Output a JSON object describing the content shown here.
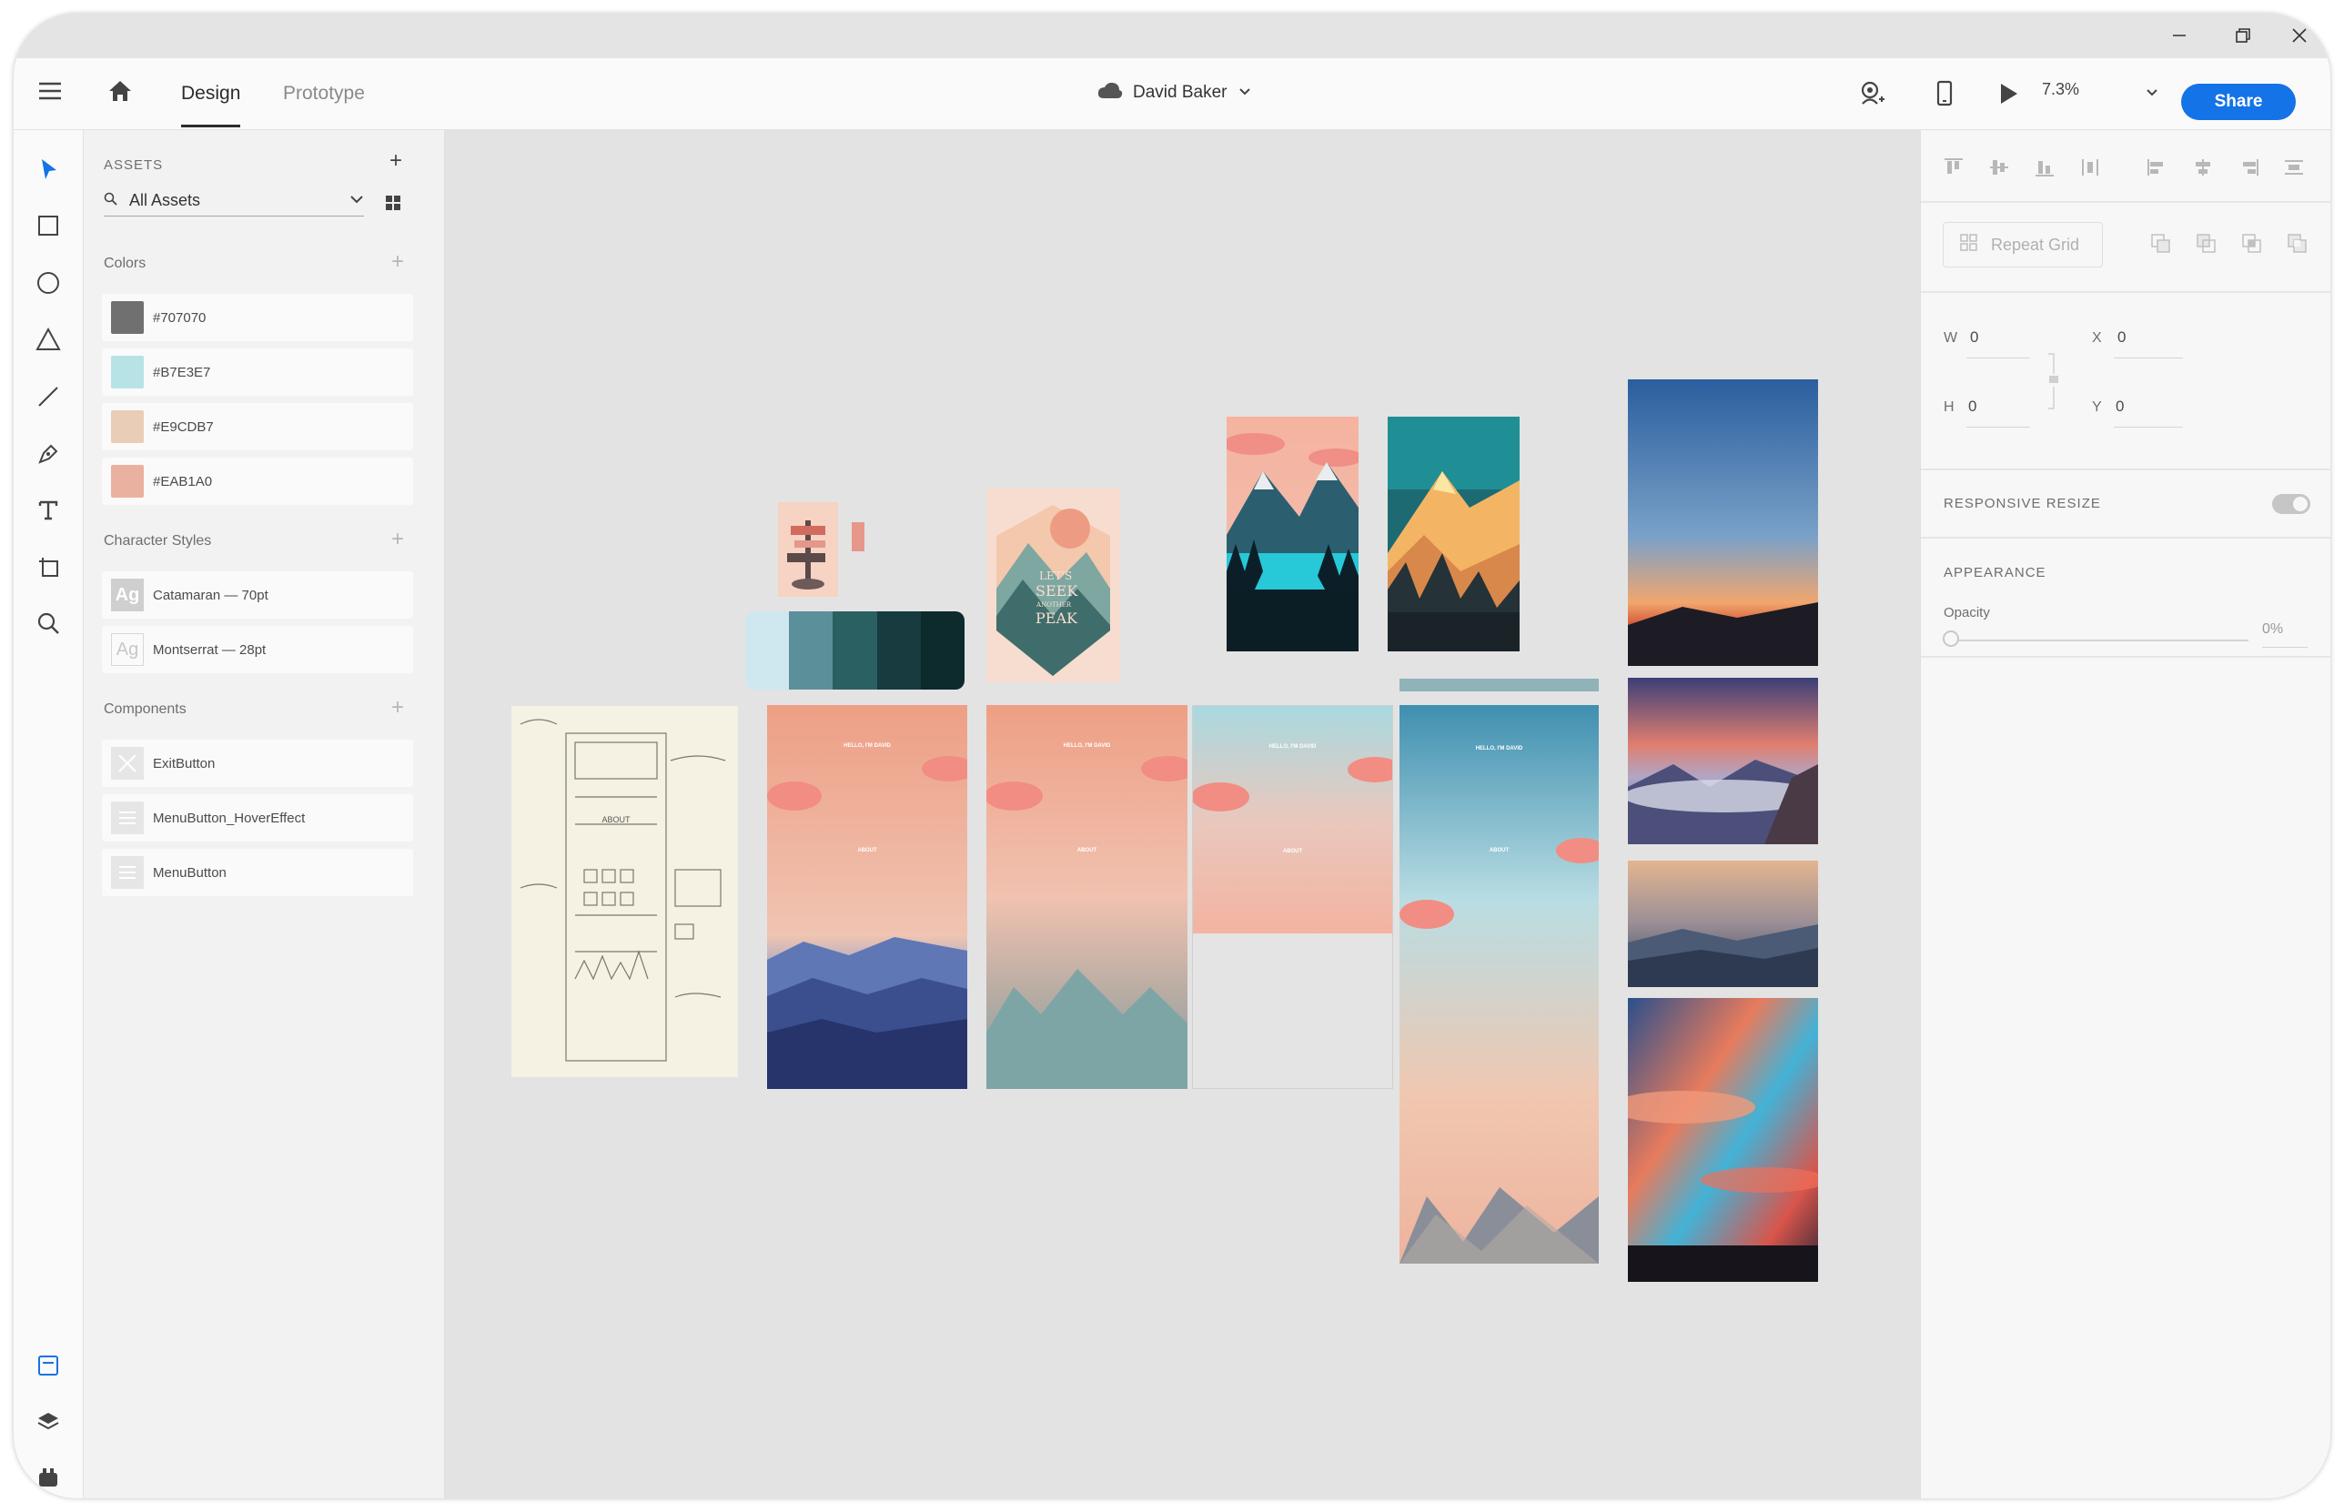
{
  "user": "David Baker",
  "tabs": [
    {
      "label": "Design",
      "active": true
    },
    {
      "label": "Prototype",
      "active": false
    }
  ],
  "zoom": "7.3%",
  "share_label": "Share",
  "assets": {
    "header": "ASSETS",
    "filter": "All Assets",
    "colors_title": "Colors",
    "colors": [
      {
        "hex": "#707070",
        "label": "#707070"
      },
      {
        "hex": "#B7E3E7",
        "label": "#B7E3E7"
      },
      {
        "hex": "#E9CDB7",
        "label": "#E9CDB7"
      },
      {
        "hex": "#EAB1A0",
        "label": "#EAB1A0"
      }
    ],
    "char_styles_title": "Character Styles",
    "char_styles": [
      {
        "icon": "Ag",
        "label": "Catamaran — 70pt"
      },
      {
        "icon": "Ag",
        "label": "Montserrat — 28pt"
      }
    ],
    "components_title": "Components",
    "components": [
      {
        "label": "ExitButton"
      },
      {
        "label": "MenuButton_HoverEffect"
      },
      {
        "label": "MenuButton"
      }
    ]
  },
  "inspector": {
    "repeat_grid": "Repeat Grid",
    "w_label": "W",
    "w_value": "0",
    "x_label": "X",
    "x_value": "0",
    "h_label": "H",
    "h_value": "0",
    "y_label": "Y",
    "y_value": "0",
    "responsive_resize": "RESPONSIVE RESIZE",
    "appearance": "APPEARANCE",
    "opacity_label": "Opacity",
    "opacity_value": "0%"
  },
  "artboards": {
    "hello": "HELLO, I'M DAVID",
    "about": "ABOUT",
    "poster_lines": [
      "LET'S",
      "SEEK",
      "ANOTHER",
      "PEAK"
    ]
  },
  "accent_color": "#1473e6"
}
